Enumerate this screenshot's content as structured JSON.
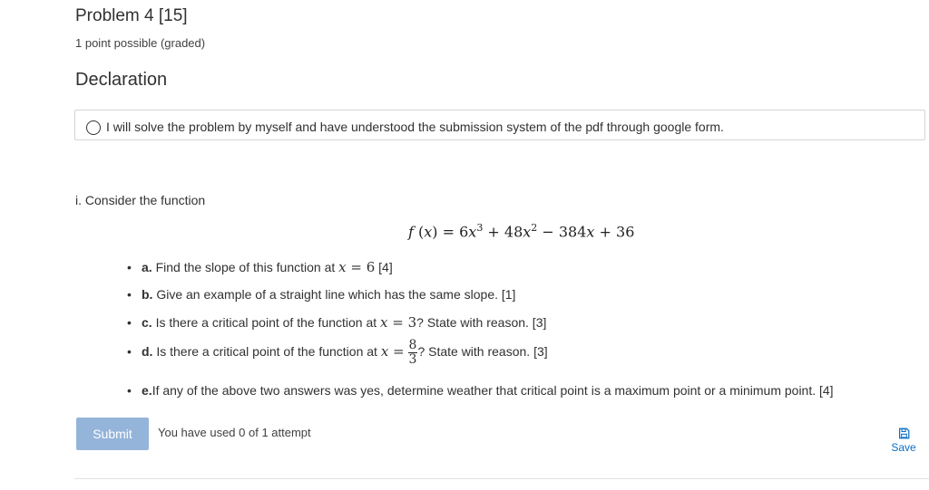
{
  "problem": {
    "title": "Problem 4 [15]",
    "points": "1 point possible (graded)"
  },
  "declaration": {
    "heading": "Declaration",
    "option_text": "I will solve the problem by myself and have understood the submission system of the pdf through google form."
  },
  "question": {
    "intro": "i. Consider the function",
    "items": [
      {
        "label": "a.",
        "before": " Find the slope of this function at ",
        "math": "x = 6",
        "after": " [4]"
      },
      {
        "label": "b.",
        "before": " Give an example of a straight line which has the same slope. [1]"
      },
      {
        "label": "c.",
        "before": " Is there a critical point of the function at ",
        "math": "x = 3",
        "after": "? State with reason. [3]"
      },
      {
        "label": "d.",
        "before": " Is there a critical point of the function at ",
        "math_prefix": "x =",
        "frac_num": "8",
        "frac_den": "3",
        "after": "? State with reason. [3]"
      },
      {
        "label": "e.",
        "before": "If any of the above two answers was yes, determine weather that critical point is a maximum point or a minimum point. [4]"
      }
    ]
  },
  "actions": {
    "submit_label": "Submit",
    "attempts_text": "You have used 0 of 1 attempt",
    "save_label": "Save",
    "save_icon": "floppy-disk-icon"
  },
  "colors": {
    "submit_bg": "#94b4d9",
    "save_link": "#0a6dc7"
  }
}
